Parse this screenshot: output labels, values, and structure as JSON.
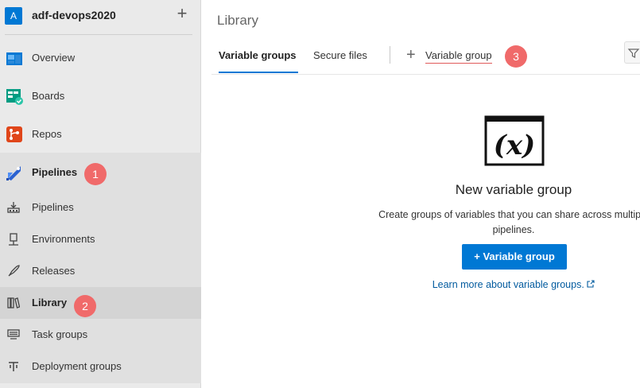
{
  "org": {
    "avatar_letter": "A",
    "name": "adf-devops2020"
  },
  "sidebar": {
    "items": [
      {
        "label": "Overview"
      },
      {
        "label": "Boards"
      },
      {
        "label": "Repos"
      },
      {
        "label": "Pipelines"
      },
      {
        "label": "Pipelines"
      },
      {
        "label": "Environments"
      },
      {
        "label": "Releases"
      },
      {
        "label": "Library"
      },
      {
        "label": "Task groups"
      },
      {
        "label": "Deployment groups"
      }
    ]
  },
  "badges": {
    "one": "1",
    "two": "2",
    "three": "3"
  },
  "main": {
    "title": "Library",
    "tabs": [
      {
        "label": "Variable groups"
      },
      {
        "label": "Secure files"
      }
    ],
    "add_button": "Variable group",
    "empty": {
      "icon_text": "(x)",
      "title": "New variable group",
      "description": "Create groups of variables that you can share across multiple pipelines.",
      "cta": "Variable group",
      "learn_more": "Learn more about variable groups."
    }
  },
  "colors": {
    "accent": "#0078d4",
    "badge": "#f06a6a",
    "sidebar_bg": "#eaeaea"
  }
}
